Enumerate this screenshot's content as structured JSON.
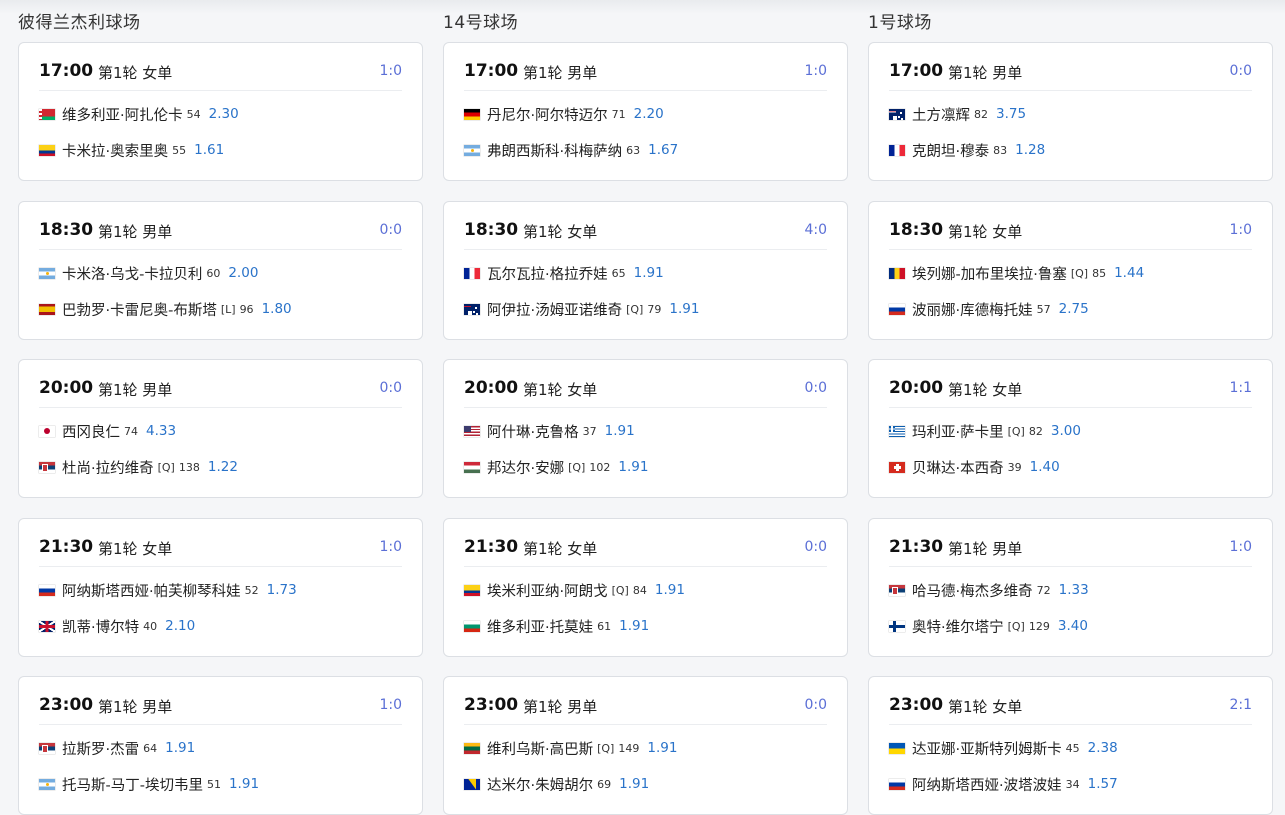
{
  "courts": [
    {
      "name": "彼得兰杰利球场",
      "matches": [
        {
          "time": "17:00",
          "round": "第1轮 女单",
          "score": "1:0",
          "players": [
            {
              "flag": "by",
              "name": "维多利亚·阿扎伦卡",
              "tag": "",
              "rank": "54",
              "odds": "2.30"
            },
            {
              "flag": "co",
              "name": "卡米拉·奥索里奥",
              "tag": "",
              "rank": "55",
              "odds": "1.61"
            }
          ]
        },
        {
          "time": "18:30",
          "round": "第1轮 男单",
          "score": "0:0",
          "players": [
            {
              "flag": "ar",
              "name": "卡米洛·乌戈-卡拉贝利",
              "tag": "",
              "rank": "60",
              "odds": "2.00"
            },
            {
              "flag": "es",
              "name": "巴勃罗·卡雷尼奥-布斯塔",
              "tag": "[L]",
              "rank": "96",
              "odds": "1.80"
            }
          ]
        },
        {
          "time": "20:00",
          "round": "第1轮 男单",
          "score": "0:0",
          "players": [
            {
              "flag": "jp",
              "name": "西冈良仁",
              "tag": "",
              "rank": "74",
              "odds": "4.33"
            },
            {
              "flag": "rs",
              "name": "杜尚·拉约维奇",
              "tag": "[Q]",
              "rank": "138",
              "odds": "1.22"
            }
          ]
        },
        {
          "time": "21:30",
          "round": "第1轮 女单",
          "score": "1:0",
          "players": [
            {
              "flag": "ru",
              "name": "阿纳斯塔西娅·帕芙柳琴科娃",
              "tag": "",
              "rank": "52",
              "odds": "1.73"
            },
            {
              "flag": "gb",
              "name": "凯蒂·博尔特",
              "tag": "",
              "rank": "40",
              "odds": "2.10"
            }
          ]
        },
        {
          "time": "23:00",
          "round": "第1轮 男单",
          "score": "1:0",
          "players": [
            {
              "flag": "rs",
              "name": "拉斯罗·杰雷",
              "tag": "",
              "rank": "64",
              "odds": "1.91"
            },
            {
              "flag": "ar",
              "name": "托马斯-马丁-埃切韦里",
              "tag": "",
              "rank": "51",
              "odds": "1.91"
            }
          ]
        }
      ]
    },
    {
      "name": "14号球场",
      "matches": [
        {
          "time": "17:00",
          "round": "第1轮 男单",
          "score": "1:0",
          "players": [
            {
              "flag": "de",
              "name": "丹尼尔·阿尔特迈尔",
              "tag": "",
              "rank": "71",
              "odds": "2.20"
            },
            {
              "flag": "ar",
              "name": "弗朗西斯科·科梅萨纳",
              "tag": "",
              "rank": "63",
              "odds": "1.67"
            }
          ]
        },
        {
          "time": "18:30",
          "round": "第1轮 女单",
          "score": "4:0",
          "players": [
            {
              "flag": "fr",
              "name": "瓦尔瓦拉·格拉乔娃",
              "tag": "",
              "rank": "65",
              "odds": "1.91"
            },
            {
              "flag": "au",
              "name": "阿伊拉·汤姆亚诺维奇",
              "tag": "[Q]",
              "rank": "79",
              "odds": "1.91"
            }
          ]
        },
        {
          "time": "20:00",
          "round": "第1轮 女单",
          "score": "0:0",
          "players": [
            {
              "flag": "us",
              "name": "阿什琳·克鲁格",
              "tag": "",
              "rank": "37",
              "odds": "1.91"
            },
            {
              "flag": "hu",
              "name": "邦达尔·安娜",
              "tag": "[Q]",
              "rank": "102",
              "odds": "1.91"
            }
          ]
        },
        {
          "time": "21:30",
          "round": "第1轮 女单",
          "score": "0:0",
          "players": [
            {
              "flag": "co",
              "name": "埃米利亚纳·阿朗戈",
              "tag": "[Q]",
              "rank": "84",
              "odds": "1.91"
            },
            {
              "flag": "bg",
              "name": "维多利亚·托莫娃",
              "tag": "",
              "rank": "61",
              "odds": "1.91"
            }
          ]
        },
        {
          "time": "23:00",
          "round": "第1轮 男单",
          "score": "0:0",
          "players": [
            {
              "flag": "lt",
              "name": "维利乌斯·高巴斯",
              "tag": "[Q]",
              "rank": "149",
              "odds": "1.91"
            },
            {
              "flag": "ba",
              "name": "达米尔·朱姆胡尔",
              "tag": "",
              "rank": "69",
              "odds": "1.91"
            }
          ]
        }
      ]
    },
    {
      "name": "1号球场",
      "matches": [
        {
          "time": "17:00",
          "round": "第1轮 男单",
          "score": "0:0",
          "players": [
            {
              "flag": "au",
              "name": "土方凛辉",
              "tag": "",
              "rank": "82",
              "odds": "3.75"
            },
            {
              "flag": "fr",
              "name": "克朗坦·穆泰",
              "tag": "",
              "rank": "83",
              "odds": "1.28"
            }
          ]
        },
        {
          "time": "18:30",
          "round": "第1轮 女单",
          "score": "1:0",
          "players": [
            {
              "flag": "ro",
              "name": "埃列娜-加布里埃拉·鲁塞",
              "tag": "[Q]",
              "rank": "85",
              "odds": "1.44"
            },
            {
              "flag": "ru",
              "name": "波丽娜·库德梅托娃",
              "tag": "",
              "rank": "57",
              "odds": "2.75"
            }
          ]
        },
        {
          "time": "20:00",
          "round": "第1轮 女单",
          "score": "1:1",
          "players": [
            {
              "flag": "gr",
              "name": "玛利亚·萨卡里",
              "tag": "[Q]",
              "rank": "82",
              "odds": "3.00"
            },
            {
              "flag": "ch",
              "name": "贝琳达·本西奇",
              "tag": "",
              "rank": "39",
              "odds": "1.40"
            }
          ]
        },
        {
          "time": "21:30",
          "round": "第1轮 男单",
          "score": "1:0",
          "players": [
            {
              "flag": "rs",
              "name": "哈马德·梅杰多维奇",
              "tag": "",
              "rank": "72",
              "odds": "1.33"
            },
            {
              "flag": "fi",
              "name": "奥特·维尔塔宁",
              "tag": "[Q]",
              "rank": "129",
              "odds": "3.40"
            }
          ]
        },
        {
          "time": "23:00",
          "round": "第1轮 女单",
          "score": "2:1",
          "players": [
            {
              "flag": "ua",
              "name": "达亚娜·亚斯特列姆斯卡",
              "tag": "",
              "rank": "45",
              "odds": "2.38"
            },
            {
              "flag": "ru",
              "name": "阿纳斯塔西娅·波塔波娃",
              "tag": "",
              "rank": "34",
              "odds": "1.57"
            }
          ]
        }
      ]
    }
  ]
}
